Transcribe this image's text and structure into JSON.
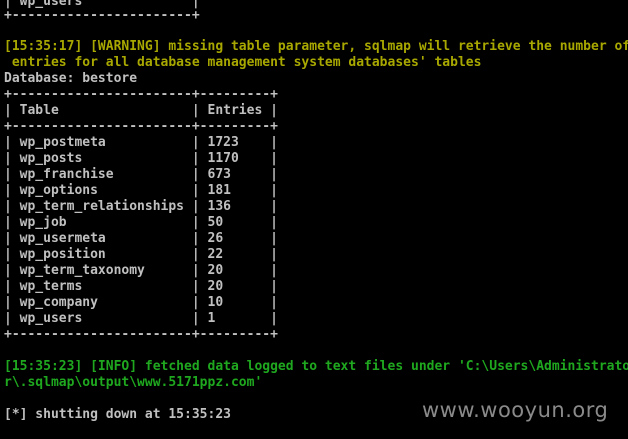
{
  "terminal": {
    "lines": {
      "l0": {
        "text": "| wp_users              |",
        "color": "gray"
      },
      "l1": {
        "text": "+-----------------------+",
        "color": "gray"
      },
      "l2": {
        "text": "[15:35:17] [WARNING] missing table parameter, sqlmap will retrieve the number of",
        "color": "warn"
      },
      "l3": {
        "text": " entries for all database management system databases' tables",
        "color": "warn"
      },
      "l4": {
        "text": "Database: bestore",
        "color": "gray"
      },
      "l5": {
        "text": "+-----------------------+---------+",
        "color": "gray"
      },
      "l6": {
        "text": "| Table                 | Entries |",
        "color": "gray"
      },
      "l7": {
        "text": "+-----------------------+---------+",
        "color": "gray"
      },
      "l8": {
        "text": "| wp_postmeta           | 1723    |",
        "color": "gray"
      },
      "l9": {
        "text": "| wp_posts              | 1170    |",
        "color": "gray"
      },
      "l10": {
        "text": "| wp_franchise          | 673     |",
        "color": "gray"
      },
      "l11": {
        "text": "| wp_options            | 181     |",
        "color": "gray"
      },
      "l12": {
        "text": "| wp_term_relationships | 136     |",
        "color": "gray"
      },
      "l13": {
        "text": "| wp_job                | 50      |",
        "color": "gray"
      },
      "l14": {
        "text": "| wp_usermeta           | 26      |",
        "color": "gray"
      },
      "l15": {
        "text": "| wp_position           | 22      |",
        "color": "gray"
      },
      "l16": {
        "text": "| wp_term_taxonomy      | 20      |",
        "color": "gray"
      },
      "l17": {
        "text": "| wp_terms              | 20      |",
        "color": "gray"
      },
      "l18": {
        "text": "| wp_company            | 10      |",
        "color": "gray"
      },
      "l19": {
        "text": "| wp_users              | 1       |",
        "color": "gray"
      },
      "l20": {
        "text": "+-----------------------+---------+",
        "color": "gray"
      },
      "l21": {
        "text": "[15:35:23] [INFO] fetched data logged to text files under 'C:\\Users\\Administrator\\.sqlmap\\output\\www.5171ppz.com'",
        "color": "info"
      },
      "l22": {
        "text": "r\\.sqlmap\\output\\www.5171ppz.com'",
        "color": "info"
      },
      "l23": {
        "text": "[*] shutting down at 15:35:23",
        "color": "gray"
      }
    }
  },
  "watermark": "www.wooyun.org",
  "colors": {
    "background": "#000000",
    "text": "#c0c0c0",
    "warning": "#a8a800",
    "info": "#1fa81f"
  }
}
